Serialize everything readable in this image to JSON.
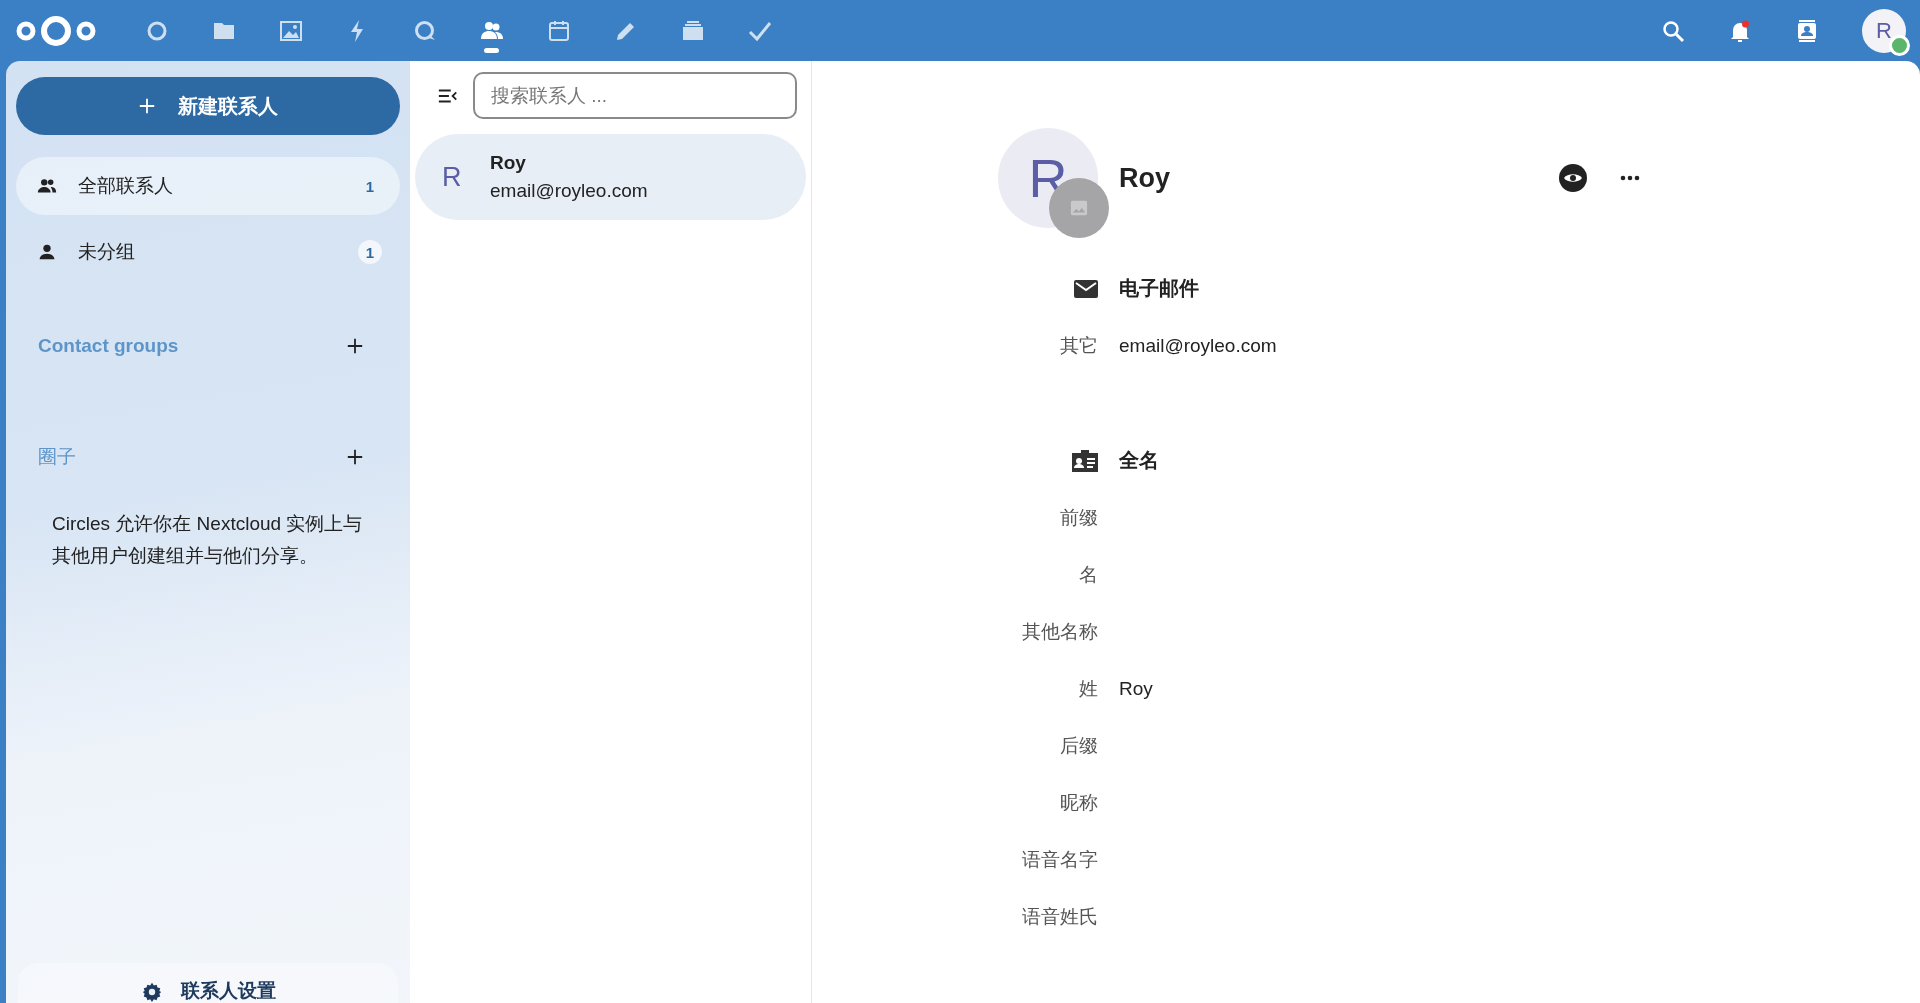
{
  "topbar": {
    "apps": [
      {
        "kind": "dashboard",
        "selected": false
      },
      {
        "kind": "files",
        "selected": false
      },
      {
        "kind": "photos",
        "selected": false
      },
      {
        "kind": "activity",
        "selected": false
      },
      {
        "kind": "talk",
        "selected": false
      },
      {
        "kind": "contacts",
        "selected": true
      },
      {
        "kind": "calendar",
        "selected": false
      },
      {
        "kind": "notes",
        "selected": false
      },
      {
        "kind": "deck",
        "selected": false
      },
      {
        "kind": "tasks",
        "selected": false
      }
    ],
    "notifications": {
      "unread": true
    },
    "user": {
      "initial": "R",
      "online": true
    }
  },
  "sidebar": {
    "new_button": "新建联系人",
    "items": [
      {
        "kind": "all",
        "label": "全部联系人",
        "count": "1",
        "selected": true
      },
      {
        "kind": "ungrouped",
        "label": "未分组",
        "count": "1",
        "selected": false
      }
    ],
    "sections": [
      {
        "title": "Contact groups"
      },
      {
        "title": "圈子"
      }
    ],
    "circles_text": "Circles 允许你在 Nextcloud 实例上与其他用户创建组并与他们分享。",
    "settings": "联系人设置"
  },
  "list": {
    "search": {
      "placeholder": "搜索联系人 ..."
    },
    "contacts": [
      {
        "initial": "R",
        "name": "Roy",
        "email": "email@royleo.com",
        "selected": true
      }
    ]
  },
  "detail": {
    "initial": "R",
    "name": "Roy",
    "sections": [
      {
        "kind": "email",
        "title": "电子邮件",
        "fields": [
          {
            "label": "其它",
            "value": "email@royleo.com"
          }
        ]
      },
      {
        "kind": "fullname",
        "title": "全名",
        "fields": [
          {
            "label": "前缀"
          },
          {
            "label": "名"
          },
          {
            "label": "其他名称"
          },
          {
            "label": "姓",
            "value": "Roy"
          },
          {
            "label": "后缀"
          },
          {
            "label": "昵称"
          },
          {
            "label": "语音名字"
          },
          {
            "label": "语音姓氏"
          }
        ]
      }
    ]
  }
}
